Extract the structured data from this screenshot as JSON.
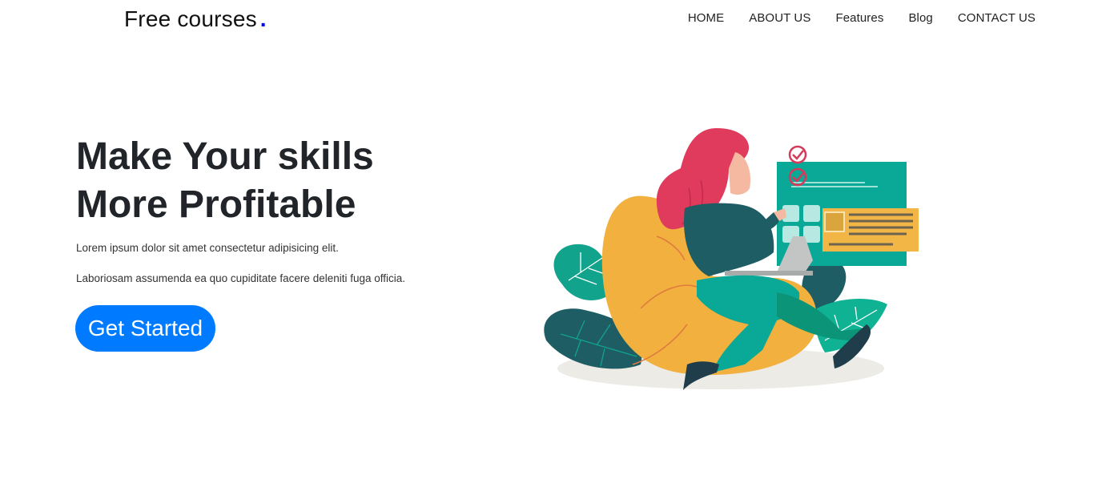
{
  "header": {
    "brand": "Free courses",
    "brand_dot": ".",
    "nav": [
      "HOME",
      "ABOUT US",
      "Features",
      "Blog",
      "CONTACT US"
    ]
  },
  "hero": {
    "title_line1": "Make Your skills",
    "title_line2": "More Profitable",
    "text1": "Lorem ipsum dolor sit amet consectetur adipisicing elit.",
    "text2": "Laboriosam assumenda ea quo cupiditate facere deleniti fuga officia.",
    "cta_label": "Get Started"
  },
  "colors": {
    "primary": "#007bff",
    "brand_dot": "#0000ff",
    "teal": "#0aa896",
    "dark_teal": "#1d5d63",
    "orange": "#f2b03f",
    "hair": "#e03a5c",
    "skin": "#f4b9a0"
  },
  "illustration": {
    "icon": "woman-on-beanbag-with-laptop-illustration"
  }
}
